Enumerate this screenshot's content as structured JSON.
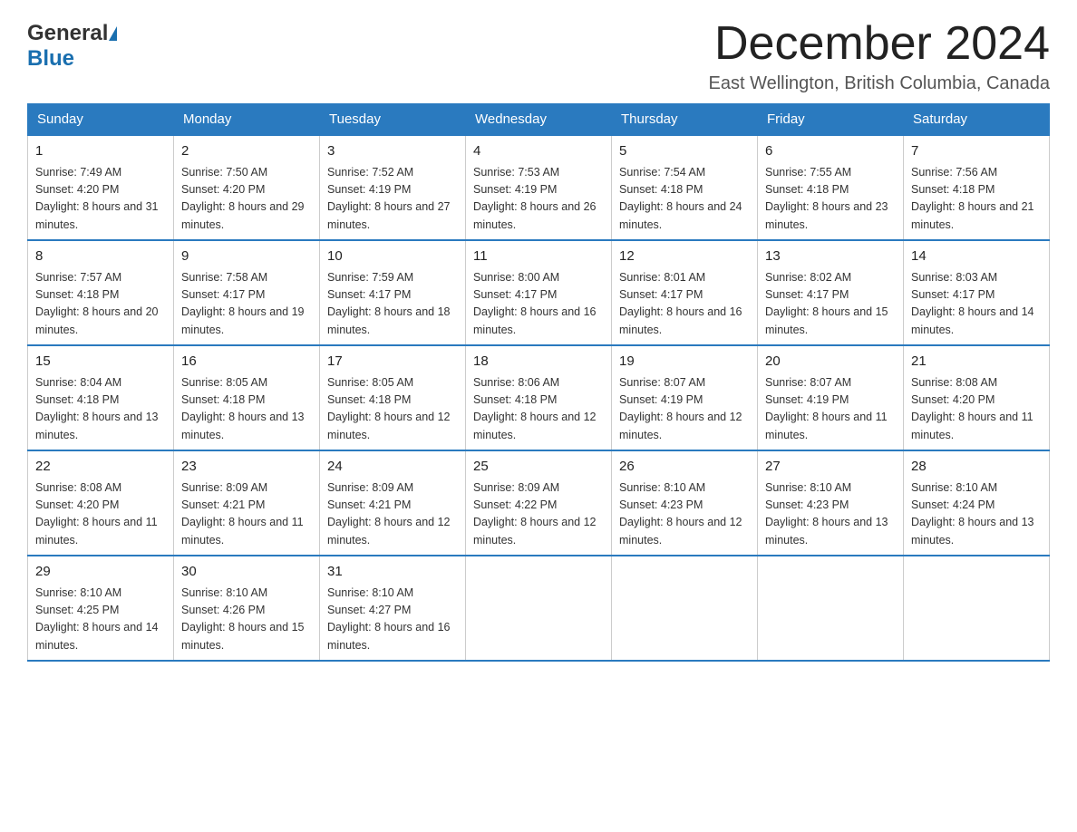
{
  "header": {
    "logo_general": "General",
    "logo_blue": "Blue",
    "month_title": "December 2024",
    "location": "East Wellington, British Columbia, Canada"
  },
  "weekdays": [
    "Sunday",
    "Monday",
    "Tuesday",
    "Wednesday",
    "Thursday",
    "Friday",
    "Saturday"
  ],
  "weeks": [
    [
      {
        "day": "1",
        "sunrise": "7:49 AM",
        "sunset": "4:20 PM",
        "daylight": "8 hours and 31 minutes."
      },
      {
        "day": "2",
        "sunrise": "7:50 AM",
        "sunset": "4:20 PM",
        "daylight": "8 hours and 29 minutes."
      },
      {
        "day": "3",
        "sunrise": "7:52 AM",
        "sunset": "4:19 PM",
        "daylight": "8 hours and 27 minutes."
      },
      {
        "day": "4",
        "sunrise": "7:53 AM",
        "sunset": "4:19 PM",
        "daylight": "8 hours and 26 minutes."
      },
      {
        "day": "5",
        "sunrise": "7:54 AM",
        "sunset": "4:18 PM",
        "daylight": "8 hours and 24 minutes."
      },
      {
        "day": "6",
        "sunrise": "7:55 AM",
        "sunset": "4:18 PM",
        "daylight": "8 hours and 23 minutes."
      },
      {
        "day": "7",
        "sunrise": "7:56 AM",
        "sunset": "4:18 PM",
        "daylight": "8 hours and 21 minutes."
      }
    ],
    [
      {
        "day": "8",
        "sunrise": "7:57 AM",
        "sunset": "4:18 PM",
        "daylight": "8 hours and 20 minutes."
      },
      {
        "day": "9",
        "sunrise": "7:58 AM",
        "sunset": "4:17 PM",
        "daylight": "8 hours and 19 minutes."
      },
      {
        "day": "10",
        "sunrise": "7:59 AM",
        "sunset": "4:17 PM",
        "daylight": "8 hours and 18 minutes."
      },
      {
        "day": "11",
        "sunrise": "8:00 AM",
        "sunset": "4:17 PM",
        "daylight": "8 hours and 16 minutes."
      },
      {
        "day": "12",
        "sunrise": "8:01 AM",
        "sunset": "4:17 PM",
        "daylight": "8 hours and 16 minutes."
      },
      {
        "day": "13",
        "sunrise": "8:02 AM",
        "sunset": "4:17 PM",
        "daylight": "8 hours and 15 minutes."
      },
      {
        "day": "14",
        "sunrise": "8:03 AM",
        "sunset": "4:17 PM",
        "daylight": "8 hours and 14 minutes."
      }
    ],
    [
      {
        "day": "15",
        "sunrise": "8:04 AM",
        "sunset": "4:18 PM",
        "daylight": "8 hours and 13 minutes."
      },
      {
        "day": "16",
        "sunrise": "8:05 AM",
        "sunset": "4:18 PM",
        "daylight": "8 hours and 13 minutes."
      },
      {
        "day": "17",
        "sunrise": "8:05 AM",
        "sunset": "4:18 PM",
        "daylight": "8 hours and 12 minutes."
      },
      {
        "day": "18",
        "sunrise": "8:06 AM",
        "sunset": "4:18 PM",
        "daylight": "8 hours and 12 minutes."
      },
      {
        "day": "19",
        "sunrise": "8:07 AM",
        "sunset": "4:19 PM",
        "daylight": "8 hours and 12 minutes."
      },
      {
        "day": "20",
        "sunrise": "8:07 AM",
        "sunset": "4:19 PM",
        "daylight": "8 hours and 11 minutes."
      },
      {
        "day": "21",
        "sunrise": "8:08 AM",
        "sunset": "4:20 PM",
        "daylight": "8 hours and 11 minutes."
      }
    ],
    [
      {
        "day": "22",
        "sunrise": "8:08 AM",
        "sunset": "4:20 PM",
        "daylight": "8 hours and 11 minutes."
      },
      {
        "day": "23",
        "sunrise": "8:09 AM",
        "sunset": "4:21 PM",
        "daylight": "8 hours and 11 minutes."
      },
      {
        "day": "24",
        "sunrise": "8:09 AM",
        "sunset": "4:21 PM",
        "daylight": "8 hours and 12 minutes."
      },
      {
        "day": "25",
        "sunrise": "8:09 AM",
        "sunset": "4:22 PM",
        "daylight": "8 hours and 12 minutes."
      },
      {
        "day": "26",
        "sunrise": "8:10 AM",
        "sunset": "4:23 PM",
        "daylight": "8 hours and 12 minutes."
      },
      {
        "day": "27",
        "sunrise": "8:10 AM",
        "sunset": "4:23 PM",
        "daylight": "8 hours and 13 minutes."
      },
      {
        "day": "28",
        "sunrise": "8:10 AM",
        "sunset": "4:24 PM",
        "daylight": "8 hours and 13 minutes."
      }
    ],
    [
      {
        "day": "29",
        "sunrise": "8:10 AM",
        "sunset": "4:25 PM",
        "daylight": "8 hours and 14 minutes."
      },
      {
        "day": "30",
        "sunrise": "8:10 AM",
        "sunset": "4:26 PM",
        "daylight": "8 hours and 15 minutes."
      },
      {
        "day": "31",
        "sunrise": "8:10 AM",
        "sunset": "4:27 PM",
        "daylight": "8 hours and 16 minutes."
      },
      null,
      null,
      null,
      null
    ]
  ],
  "labels": {
    "sunrise": "Sunrise:",
    "sunset": "Sunset:",
    "daylight": "Daylight:"
  }
}
